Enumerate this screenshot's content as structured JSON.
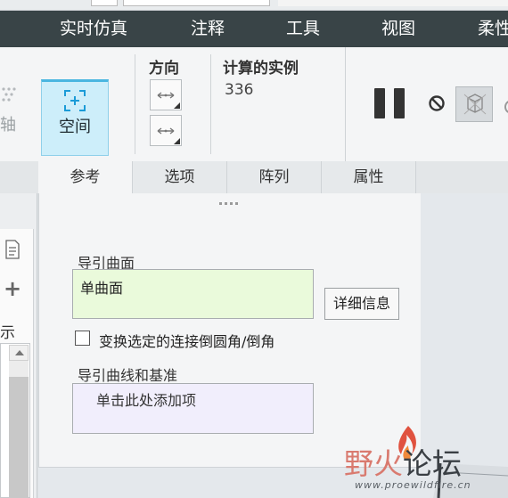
{
  "menu": {
    "items": [
      "实时仿真",
      "注释",
      "工具",
      "视图",
      "柔性"
    ]
  },
  "ribbon": {
    "axis_label": "轴",
    "space_button_label": "空间",
    "direction_title": "方向",
    "calculated_instances_title": "计算的实例",
    "calculated_instances_value": "336"
  },
  "tabs": [
    "参考",
    "选项",
    "阵列",
    "属性"
  ],
  "left_pane": {
    "show_label": "示"
  },
  "panel": {
    "guide_surface_label": "导引曲面",
    "guide_surface_value": "单曲面",
    "details_button": "详细信息",
    "checkbox_label": "变换选定的连接倒圆角/倒角",
    "guide_curves_label": "导引曲线和基准",
    "guide_curves_hint": "单击此处添加项"
  },
  "watermark": {
    "char1": "野",
    "char2": "火",
    "text_dark": "论坛",
    "url": "www.proewildfire.cn"
  },
  "colors": {
    "menu_bg": "#394447",
    "active_button_bg": "#cdeefa",
    "surface_box_bg": "#eafadb",
    "curve_box_bg": "#f1eefc"
  }
}
